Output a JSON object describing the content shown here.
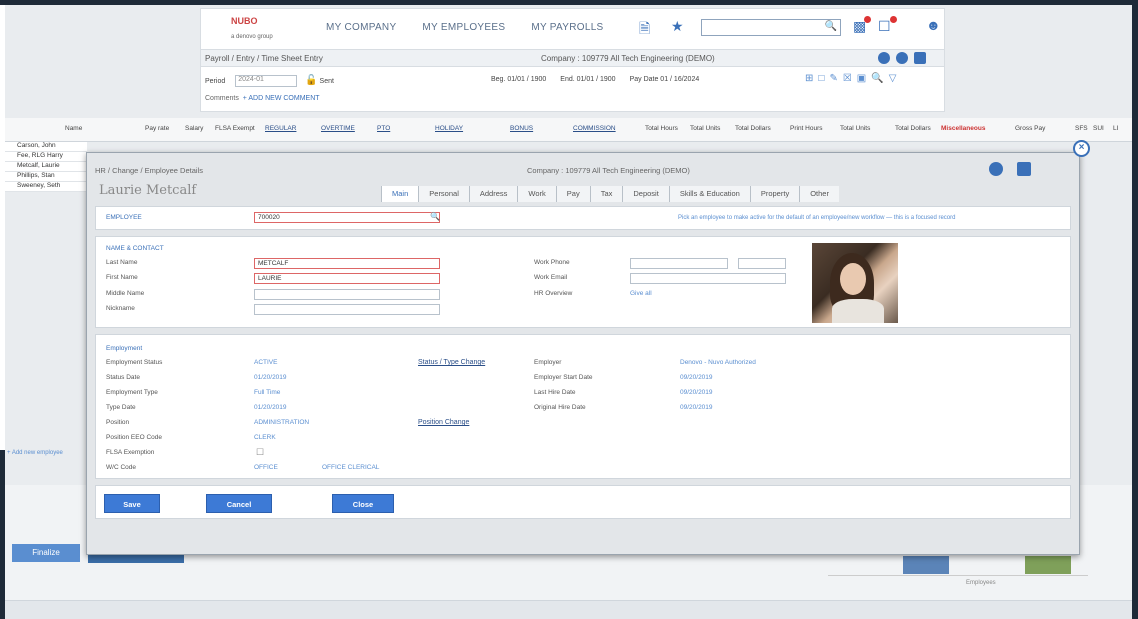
{
  "header": {
    "logo_brand": "NUBO",
    "logo_sub": "a denovo group",
    "nav": [
      "MY COMPANY",
      "MY EMPLOYEES",
      "MY PAYROLLS"
    ],
    "breadcrumb": "Payroll / Entry / Time Sheet Entry",
    "company": "Company : 109779 All Tech Engineering (DEMO)",
    "period_label": "Period",
    "period_value": "2024-01",
    "status_word": "Sent",
    "dates": [
      "Beg. 01/01 / 1900",
      "End. 01/01 / 1900",
      "Pay Date 01 / 16/2024"
    ],
    "row4_label": "Comments",
    "row4_link": "+ ADD NEW COMMENT"
  },
  "grid": {
    "columns": [
      "Name",
      "Pay rate",
      "Salary",
      "FLSA Exempt",
      "REGULAR",
      "OVERTIME",
      "PTO",
      "HOLIDAY",
      "BONUS",
      "COMMISSION",
      "Total Hours",
      "Total Units",
      "Total Dollars",
      "Print Hours",
      "Total Units",
      "Total Dollars",
      "Miscellaneous",
      "Gross Pay",
      "SFS",
      "SUI",
      "LI"
    ],
    "red_column": "Miscellaneous",
    "rows": [
      "Carson, John",
      "Fee, RLG Harry",
      "Metcalf, Laurie",
      "Phillips, Stan",
      "Sweeney, Seth"
    ]
  },
  "side_link": "+ Add new employee",
  "bottom_button": "Finalize",
  "legend_text": "Employees",
  "modal": {
    "title": "HR / Change / Employee Details",
    "company": "Company : 109779 All Tech Engineering (DEMO)",
    "employee_name": "Laurie Metcalf",
    "tabs": [
      "Main",
      "Personal",
      "Address",
      "Work",
      "Pay",
      "Tax",
      "Deposit",
      "Skills & Education",
      "Property",
      "Other"
    ],
    "active_tab": "Main",
    "employee_label": "EMPLOYEE",
    "employee_value": "700020",
    "notice": "Pick an employee to make active for the default of an employee/new workflow — this is a focused record",
    "name_section": "NAME & CONTACT",
    "last_name_label": "Last Name",
    "last_name_value": "METCALF",
    "first_name_label": "First Name",
    "first_name_value": "LAURIE",
    "middle_name_label": "Middle Name",
    "nickname_label": "Nickname",
    "work_phone_label": "Work Phone",
    "work_email_label": "Work Email",
    "hr_overview_label": "HR Overview",
    "hr_overview_value": "Give all",
    "employment_section": "Employment",
    "left_labels": [
      "Employment Status",
      "Status Date",
      "Employment Type",
      "Type Date",
      "Position",
      "Position EEO Code",
      "FLSA Exemption",
      "W/C Code"
    ],
    "left_values": [
      "ACTIVE",
      "01/20/2019",
      "Full Time",
      "01/20/2019",
      "ADMINISTRATION",
      "CLERK",
      "",
      "OFFICE"
    ],
    "wc_extra": "OFFICE CLERICAL",
    "flsa_checkbox": "☐",
    "change_status_link": "Status / Type Change",
    "position_change_link": "Position Change",
    "right_labels": [
      "Employer",
      "Employer Start Date",
      "Last Hire Date",
      "Original Hire Date"
    ],
    "right_values": [
      "Denovo - Nuvo Authorized",
      "09/20/2019",
      "09/20/2019",
      "09/20/2019"
    ],
    "buttons": {
      "save": "Save",
      "cancel": "Cancel",
      "close": "Close"
    }
  },
  "colors": {
    "accent": "#3d7ad6",
    "link": "#2a4e88",
    "required": "#d66666",
    "frame": "#1e2a38"
  }
}
